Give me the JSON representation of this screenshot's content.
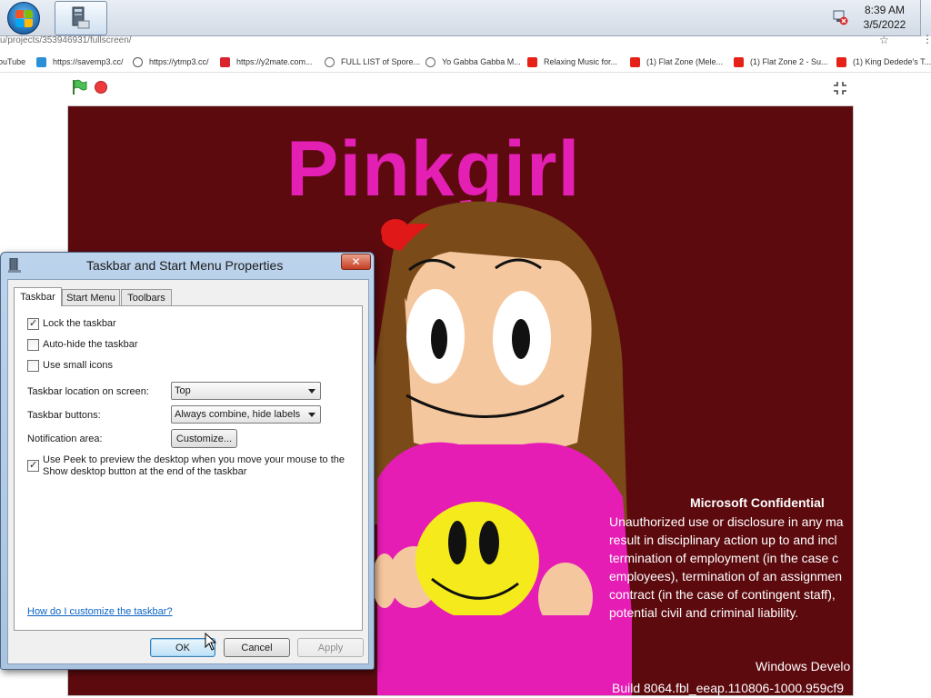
{
  "taskbar": {
    "clock_time": "8:39 AM",
    "clock_date": "3/5/2022",
    "start_icon": "windows-start-orb",
    "task_icon": "control-panel-window-icon",
    "tray_icon": "network-disconnected-icon"
  },
  "browser": {
    "url": "u/projects/353946931/fullscreen/",
    "star_icon": "☆",
    "menu_icon": "⋮",
    "bookmarks": [
      {
        "label": "ouTube",
        "icon": "youtube-icon",
        "color": "#ffffff"
      },
      {
        "label": "https://savemp3.cc/",
        "icon": "savemp3-icon",
        "color": "#2a8fd6"
      },
      {
        "label": "https://ytmp3.cc/",
        "icon": "ytmp3-icon",
        "color": "#555555"
      },
      {
        "label": "https://y2mate.com...",
        "icon": "y2mate-icon",
        "color": "#d9232d"
      },
      {
        "label": "FULL LIST of Spore...",
        "icon": "globe-icon",
        "color": "#666666"
      },
      {
        "label": "Yo Gabba Gabba M...",
        "icon": "globe-icon",
        "color": "#666666"
      },
      {
        "label": "Relaxing Music for...",
        "icon": "youtube-icon",
        "color": "#e62117"
      },
      {
        "label": "(1) Flat Zone (Mele...",
        "icon": "youtube-icon",
        "color": "#e62117"
      },
      {
        "label": "(1) Flat Zone 2 - Su...",
        "icon": "youtube-icon",
        "color": "#e62117"
      },
      {
        "label": "(1) King Dedede's T...",
        "icon": "youtube-icon",
        "color": "#e62117"
      }
    ]
  },
  "player": {
    "green_flag_icon": "green-flag-icon",
    "stop_icon": "stop-sign-icon",
    "fullscreen_icon": "exit-fullscreen-icon"
  },
  "stage": {
    "title": "Pinkgirl",
    "watermark_title": "Microsoft Confidential",
    "watermark_lines": [
      "Unauthorized use or disclosure in any ma",
      "result in disciplinary action up to and incl",
      "termination of employment (in the case c",
      "employees), termination of an assignmen",
      "contract (in the case of contingent staff),",
      "potential civil and criminal liability."
    ],
    "watermark_version": "Windows Develo",
    "watermark_build": "Build 8064.fbl_eeap.110806-1000.959cf9"
  },
  "dialog": {
    "title": "Taskbar and Start Menu Properties",
    "close_label": "✕",
    "tabs": [
      {
        "label": "Taskbar",
        "active": true
      },
      {
        "label": "Start Menu",
        "active": false
      },
      {
        "label": "Toolbars",
        "active": false
      }
    ],
    "checkboxes": [
      {
        "label": "Lock the taskbar",
        "checked": true
      },
      {
        "label": "Auto-hide the taskbar",
        "checked": false
      },
      {
        "label": "Use small icons",
        "checked": false
      }
    ],
    "location_label": "Taskbar location on screen:",
    "location_value": "Top",
    "buttons_label": "Taskbar buttons:",
    "buttons_value": "Always combine, hide labels",
    "notification_label": "Notification area:",
    "customize_label": "Customize...",
    "peek_line1": "Use Peek to preview the desktop when you move your mouse to the",
    "peek_line2": "Show desktop button at the end of the taskbar",
    "peek_checked": true,
    "help_link": "How do I customize the taskbar?",
    "ok_label": "OK",
    "cancel_label": "Cancel",
    "apply_label": "Apply"
  }
}
